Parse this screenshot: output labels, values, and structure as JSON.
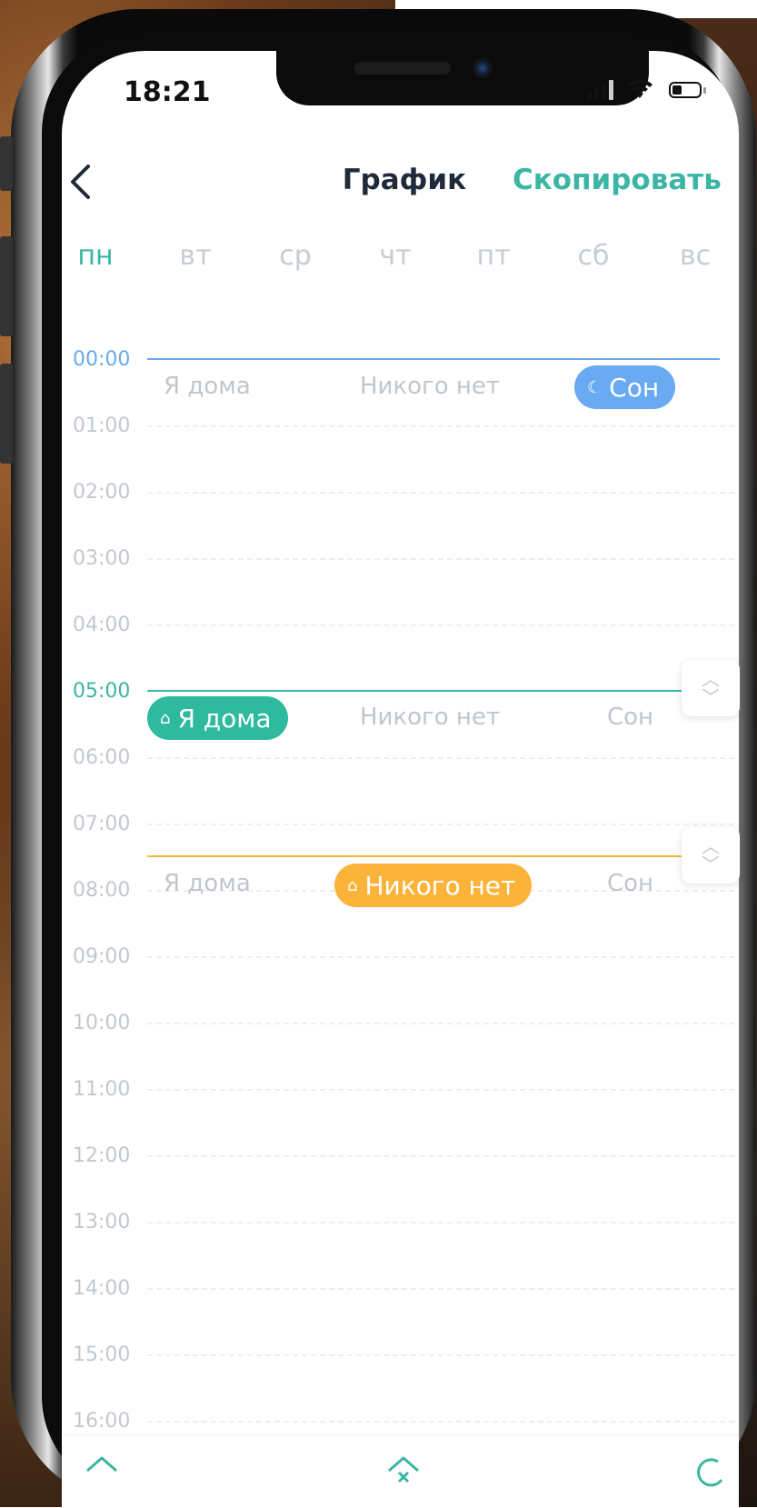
{
  "status_bar": {
    "time": "18:21"
  },
  "header": {
    "title": "График",
    "copy_label": "Скопировать"
  },
  "days": [
    {
      "label": "пн",
      "active": true
    },
    {
      "label": "вт",
      "active": false
    },
    {
      "label": "ср",
      "active": false
    },
    {
      "label": "чт",
      "active": false
    },
    {
      "label": "пт",
      "active": false
    },
    {
      "label": "сб",
      "active": false
    },
    {
      "label": "вс",
      "active": false
    }
  ],
  "hours": [
    "00:00",
    "01:00",
    "02:00",
    "03:00",
    "04:00",
    "05:00",
    "06:00",
    "07:00",
    "08:00",
    "09:00",
    "10:00",
    "11:00",
    "12:00",
    "13:00",
    "14:00",
    "15:00",
    "16:00"
  ],
  "slots": [
    {
      "start": "00:00",
      "color": "#6aa9ee",
      "modes": [
        "Я дома",
        "Никого нет",
        "Сон"
      ],
      "selected": "Сон"
    },
    {
      "start": "05:00",
      "color": "#3bb5a4",
      "modes": [
        "Я дома",
        "Никого нет",
        "Сон"
      ],
      "selected": "Я дома"
    },
    {
      "start": "07:30",
      "color": "#fbb33a",
      "modes": [
        "Я дома",
        "Никого нет",
        "Сон"
      ],
      "selected": "Никого нет"
    }
  ],
  "colors": {
    "accent": "#3bb5a4",
    "sleep": "#6aaaf2",
    "home": "#2fba9f",
    "away": "#fbb33a"
  },
  "icons": {
    "back": "chevron-left-icon",
    "sleep": "moon-icon",
    "home": "house-check-icon",
    "away": "house-x-icon",
    "handle": "chevron-up-down-icon"
  }
}
